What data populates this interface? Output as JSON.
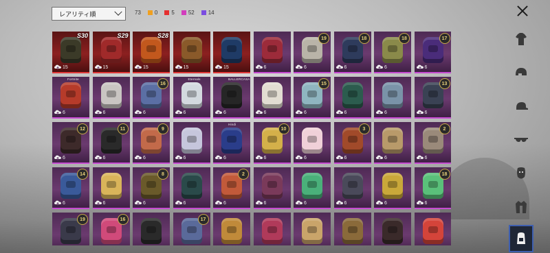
{
  "toolbar": {
    "sort_value": "レアリティ順",
    "total_count": "73",
    "rarity_counts": [
      {
        "color": "#f0a020",
        "count": "0"
      },
      {
        "color": "#e53030",
        "count": "5"
      },
      {
        "color": "#d23dbd",
        "count": "52"
      },
      {
        "color": "#7b4de0",
        "count": "14"
      }
    ]
  },
  "close_icon": "close-icon",
  "sidebar": {
    "items": [
      {
        "icon": "outfit-icon",
        "active": false
      },
      {
        "icon": "helmet-icon",
        "active": false
      },
      {
        "icon": "cap-icon",
        "active": false
      },
      {
        "icon": "glasses-icon",
        "active": false
      },
      {
        "icon": "mask-icon",
        "active": false
      },
      {
        "icon": "jacket-icon",
        "active": false
      },
      {
        "icon": "backpack-icon",
        "active": true
      }
    ]
  },
  "items": [
    {
      "rarity": "red",
      "season": "S30",
      "count": "15",
      "color": "#3b3a28"
    },
    {
      "rarity": "red",
      "season": "S29",
      "count": "15",
      "color": "#a02a2a"
    },
    {
      "rarity": "red",
      "season": "S28",
      "count": "15",
      "color": "#c2581d"
    },
    {
      "rarity": "red",
      "count": "15",
      "color": "#8a5a2a"
    },
    {
      "rarity": "red",
      "count": "15",
      "color": "#1f3b66"
    },
    {
      "rarity": "purple",
      "count": "6",
      "color": "#9c2b3a"
    },
    {
      "rarity": "purple",
      "level": "19",
      "count": "6",
      "color": "#b9b4a8"
    },
    {
      "rarity": "purple",
      "level": "18",
      "count": "6",
      "color": "#2e3b5c"
    },
    {
      "rarity": "purple",
      "level": "18",
      "count": "6",
      "color": "#8a8a4a"
    },
    {
      "rarity": "purple",
      "level": "17",
      "count": "6",
      "color": "#4a2c7a"
    },
    {
      "rarity": "purple",
      "tag": "Fortnite",
      "count": "6",
      "color": "#b63b2a"
    },
    {
      "rarity": "purple",
      "count": "6",
      "color": "#c9c5c2"
    },
    {
      "rarity": "purple",
      "level": "16",
      "count": "6",
      "color": "#5b6fa4"
    },
    {
      "rarity": "purple",
      "tag": "Eternals",
      "count": "6",
      "color": "#d3d9df"
    },
    {
      "rarity": "purple",
      "tag": "BALLERCASA",
      "count": "6",
      "color": "#262626"
    },
    {
      "rarity": "purple",
      "count": "6",
      "color": "#e2ddd2"
    },
    {
      "rarity": "purple",
      "level": "15",
      "count": "6",
      "color": "#8fb5c0"
    },
    {
      "rarity": "purple",
      "count": "6",
      "color": "#2c5c4e"
    },
    {
      "rarity": "purple",
      "count": "6",
      "color": "#7a93a8"
    },
    {
      "rarity": "purple",
      "level": "13",
      "count": "6",
      "color": "#3a4254"
    },
    {
      "rarity": "purple",
      "level": "12",
      "count": "6",
      "color": "#3d2a2a"
    },
    {
      "rarity": "purple",
      "level": "11",
      "count": "6",
      "color": "#2a2a2a"
    },
    {
      "rarity": "purple",
      "level": "9",
      "count": "6",
      "color": "#c26a4a"
    },
    {
      "rarity": "purple",
      "count": "6",
      "color": "#c6c6dc"
    },
    {
      "rarity": "purple",
      "tag": "Hindi",
      "count": "6",
      "color": "#2a3d8a"
    },
    {
      "rarity": "purple",
      "level": "10",
      "count": "6",
      "color": "#d4b04a"
    },
    {
      "rarity": "purple",
      "count": "6",
      "color": "#f0d0d8"
    },
    {
      "rarity": "purple",
      "level": "3",
      "count": "6",
      "color": "#a14a2a"
    },
    {
      "rarity": "purple",
      "count": "6",
      "color": "#b89a6a"
    },
    {
      "rarity": "purple",
      "level": "2",
      "count": "6",
      "color": "#9a8a7a"
    },
    {
      "rarity": "purple",
      "level": "14",
      "count": "6",
      "color": "#3a5a9a"
    },
    {
      "rarity": "purple",
      "count": "6",
      "color": "#d9b45a"
    },
    {
      "rarity": "purple",
      "level": "8",
      "count": "6",
      "color": "#6a5a2a"
    },
    {
      "rarity": "purple",
      "count": "6",
      "color": "#2a4a4a"
    },
    {
      "rarity": "purple",
      "level": "2",
      "count": "6",
      "color": "#c25a3a"
    },
    {
      "rarity": "purple",
      "count": "6",
      "color": "#7a3a5a"
    },
    {
      "rarity": "purple",
      "count": "6",
      "color": "#4ab07a"
    },
    {
      "rarity": "purple",
      "count": "6",
      "color": "#4a4a5a"
    },
    {
      "rarity": "purple",
      "count": "6",
      "color": "#c9a83a"
    },
    {
      "rarity": "purple",
      "level": "18",
      "count": "6",
      "color": "#5ac07a"
    },
    {
      "rarity": "purple",
      "level": "19",
      "count": "6",
      "color": "#3a3a4a"
    },
    {
      "rarity": "purple",
      "level": "16",
      "count": "6",
      "color": "#d04a7a"
    },
    {
      "rarity": "purple",
      "count": "6",
      "color": "#2a2a2a"
    },
    {
      "rarity": "purple",
      "level": "17",
      "count": "6",
      "color": "#5a6a9a"
    },
    {
      "rarity": "purple",
      "count": "6",
      "color": "#c08a3a"
    },
    {
      "rarity": "purple",
      "count": "6",
      "color": "#b03a5a"
    },
    {
      "rarity": "purple",
      "count": "6",
      "color": "#c9a46a"
    },
    {
      "rarity": "purple",
      "count": "6",
      "color": "#8a6a3a"
    },
    {
      "rarity": "purple",
      "count": "6",
      "color": "#3a2a2a"
    },
    {
      "rarity": "purple",
      "count": "6",
      "color": "#d4443a"
    }
  ]
}
